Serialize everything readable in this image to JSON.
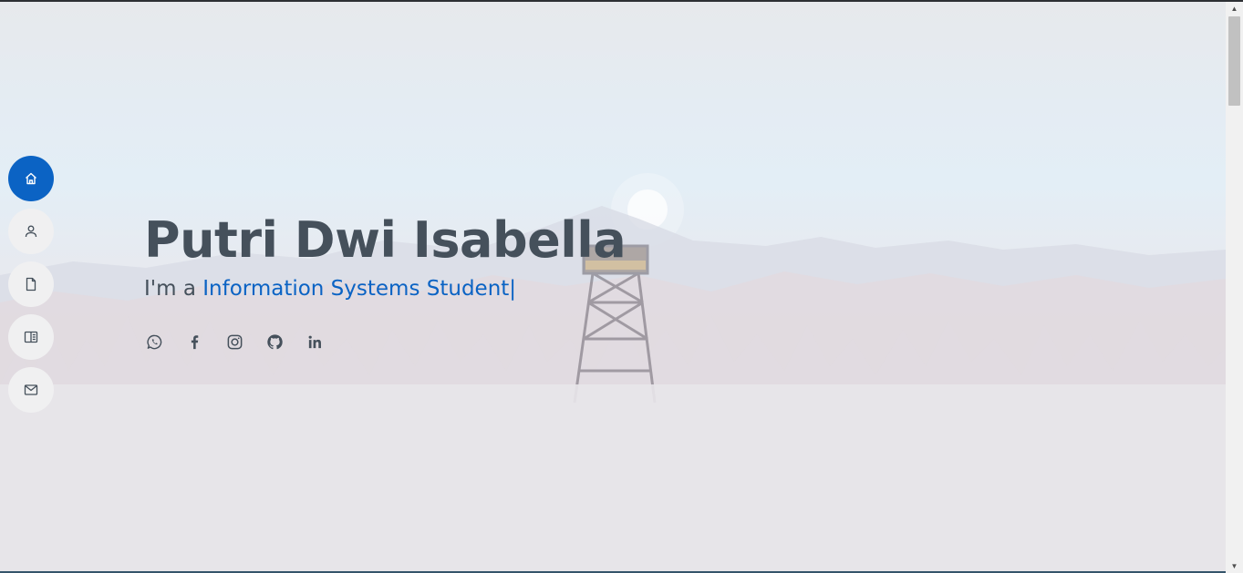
{
  "nav": {
    "items": [
      {
        "name": "nav-home",
        "icon": "home-icon",
        "active": true
      },
      {
        "name": "nav-about",
        "icon": "person-icon",
        "active": false
      },
      {
        "name": "nav-resume",
        "icon": "file-icon",
        "active": false
      },
      {
        "name": "nav-portfolio",
        "icon": "book-icon",
        "active": false
      },
      {
        "name": "nav-contact",
        "icon": "envelope-icon",
        "active": false
      }
    ]
  },
  "hero": {
    "name": "Putri Dwi Isabella",
    "prefix": "I'm a ",
    "typed": "Information Systems Student",
    "cursor": "|"
  },
  "socials": [
    {
      "name": "whatsapp-link",
      "icon": "whatsapp-icon"
    },
    {
      "name": "facebook-link",
      "icon": "facebook-icon"
    },
    {
      "name": "instagram-link",
      "icon": "instagram-icon"
    },
    {
      "name": "github-link",
      "icon": "github-icon"
    },
    {
      "name": "linkedin-link",
      "icon": "linkedin-icon"
    }
  ],
  "colors": {
    "accent": "#0b63c4",
    "text": "#45505b",
    "nav_bg": "#f0f0f1"
  }
}
